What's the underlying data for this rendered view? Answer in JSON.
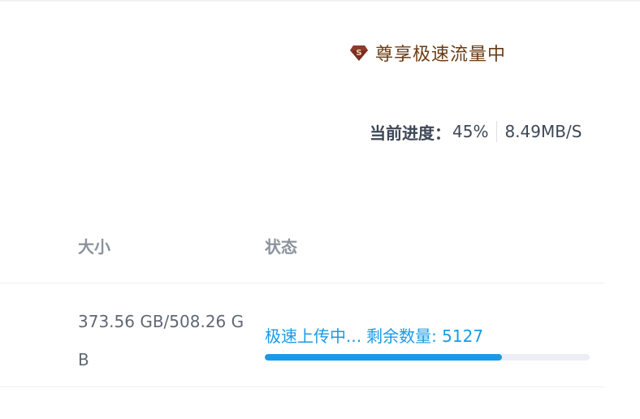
{
  "vip": {
    "icon": "gem-icon",
    "label": "尊享极速流量中",
    "color": "#6b3b12"
  },
  "progress": {
    "label": "当前进度：",
    "value": "45%",
    "speed": "8.49MB/S"
  },
  "table": {
    "columns": [
      "大小",
      "状态"
    ],
    "rows": [
      {
        "size": "373.56 GB/508.26 GB",
        "status_text": "极速上传中...",
        "remaining_label": "剩余数量: 5127",
        "bar_fraction": 0.73,
        "bar_color": "#1a9ae6"
      }
    ]
  }
}
